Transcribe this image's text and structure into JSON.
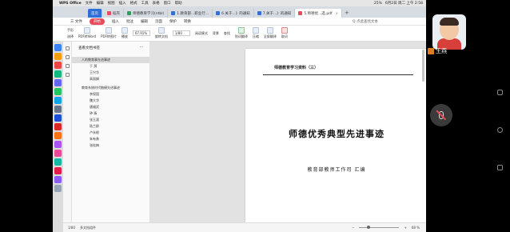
{
  "menubar": {
    "app_name": "WPS Office",
    "items": [
      "文件",
      "编辑",
      "视图",
      "插入",
      "格式",
      "工具",
      "表格",
      "窗口",
      "帮助"
    ],
    "clock": "6月2日 周二 上午 2:58",
    "battery": "25%"
  },
  "tabs": [
    {
      "label": "首页",
      "type": "home"
    },
    {
      "label": "稻壳",
      "type": "normal"
    },
    {
      "label": "师德教育学习(ntbl)",
      "type": "normal"
    },
    {
      "label": "1.教育部...职业行...",
      "type": "normal"
    },
    {
      "label": "6.关于...》的通知",
      "type": "normal"
    },
    {
      "label": "7.关于...》的通知",
      "type": "normal"
    },
    {
      "label": "5.师德优...选.pdf",
      "type": "active"
    }
  ],
  "ribbon_menu": {
    "file": "三 文件",
    "items": [
      "开始",
      "插入",
      "批注",
      "编辑",
      "页面",
      "保护",
      "转换"
    ],
    "selected": "开始",
    "search": "Q 点此查找文本"
  },
  "toolbar": {
    "items": [
      {
        "label": "PDF转Word",
        "icon": "pdf-to-word-icon"
      },
      {
        "label": "PDF转图片",
        "icon": "pdf-to-image-icon"
      },
      {
        "label": "播放",
        "icon": "play-icon"
      },
      {
        "label": "旋转文档",
        "icon": "rotate-icon"
      },
      {
        "label": "划词翻译",
        "icon": "translate-icon"
      },
      {
        "label": "压缩",
        "icon": "compress-icon"
      },
      {
        "label": "全屏显示",
        "icon": "fullscreen-icon"
      },
      {
        "label": "取词",
        "icon": "word-pick-icon"
      }
    ],
    "zoom": "67.91%",
    "page_input": "1/80",
    "side_actions": [
      "手形",
      "选择"
    ],
    "extra": [
      "阅读模式",
      "背景",
      "查找",
      "全屏翻译"
    ]
  },
  "sidebar": {
    "title": "查看文档书签",
    "items": [
      {
        "label": "人的教育事先进事迹",
        "level": 1,
        "selected": true
      },
      {
        "label": "于 漪",
        "level": 2
      },
      {
        "label": "王兴华",
        "level": 2
      },
      {
        "label": "高丽娟",
        "level": 2
      },
      {
        "label": "教育系统时代楷模先进事迹",
        "level": 1
      },
      {
        "label": "李保国",
        "level": 2
      },
      {
        "label": "魏大华",
        "level": 2
      },
      {
        "label": "唐福武",
        "level": 2
      },
      {
        "label": "钟 扬",
        "level": 2
      },
      {
        "label": "张玉滚",
        "level": 2
      },
      {
        "label": "陆兰群",
        "level": 2
      },
      {
        "label": "卢永根",
        "level": 2
      },
      {
        "label": "朱有勇",
        "level": 2
      },
      {
        "label": "张桂梅",
        "level": 2
      }
    ]
  },
  "document": {
    "header": "师德教育学习资料（三）",
    "title": "师德优秀典型先进事迹",
    "subtitle": "教育部教师工作司  汇编"
  },
  "statusbar": {
    "page": "1/80",
    "annotation": "多文档组件",
    "zoom_percent": "68 %",
    "zoom_level": 0.2
  },
  "call": {
    "user_name": "王燕"
  }
}
